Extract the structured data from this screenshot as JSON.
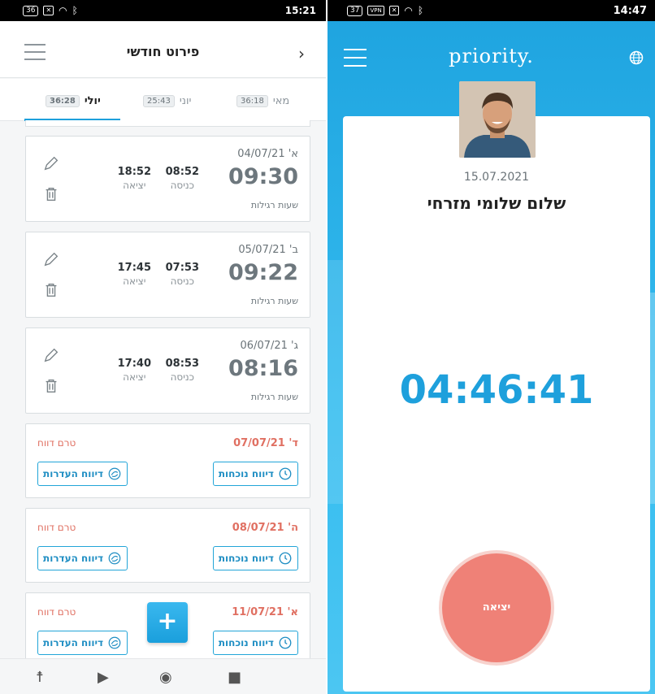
{
  "left": {
    "status": {
      "battery": "36",
      "time": "15:21"
    },
    "header": {
      "title": "פירוט חודשי",
      "back": "›"
    },
    "tabs": [
      {
        "label": "יולי",
        "count": "36:28",
        "active": true
      },
      {
        "label": "יוני",
        "count": "25:43",
        "active": false
      },
      {
        "label": "מאי",
        "count": "36:18",
        "active": false
      }
    ],
    "days": [
      {
        "date": "א' 04/07/21",
        "total": "09:30",
        "kind": "שעות רגילות",
        "in": "08:52",
        "out": "18:52",
        "in_label": "כניסה",
        "out_label": "יציאה"
      },
      {
        "date": "ב' 05/07/21",
        "total": "09:22",
        "kind": "שעות רגילות",
        "in": "07:53",
        "out": "17:45",
        "in_label": "כניסה",
        "out_label": "יציאה"
      },
      {
        "date": "ג' 06/07/21",
        "total": "08:16",
        "kind": "שעות רגילות",
        "in": "08:53",
        "out": "17:40",
        "in_label": "כניסה",
        "out_label": "יציאה"
      }
    ],
    "pending": [
      {
        "date": "ד' 07/07/21",
        "status": "טרם דווח",
        "attendance": "דיווח נוכחות",
        "absence": "דיווח העדרות"
      },
      {
        "date": "ה' 08/07/21",
        "status": "טרם דווח",
        "attendance": "דיווח נוכחות",
        "absence": "דיווח העדרות"
      },
      {
        "date": "א' 11/07/21",
        "status": "טרם דווח",
        "attendance": "דיווח נוכחות",
        "absence": "דיווח העדרות"
      }
    ],
    "fab": "+"
  },
  "right": {
    "status": {
      "battery": "37",
      "time": "14:47"
    },
    "logo": "priority.",
    "date": "15.07.2021",
    "greeting": "שלום שלומי מזרחי",
    "clock": "04:46:41",
    "exit": "יציאה"
  },
  "colors": {
    "accent": "#1ea0dc",
    "draft": "#e07062",
    "exit": "#ef8177"
  }
}
